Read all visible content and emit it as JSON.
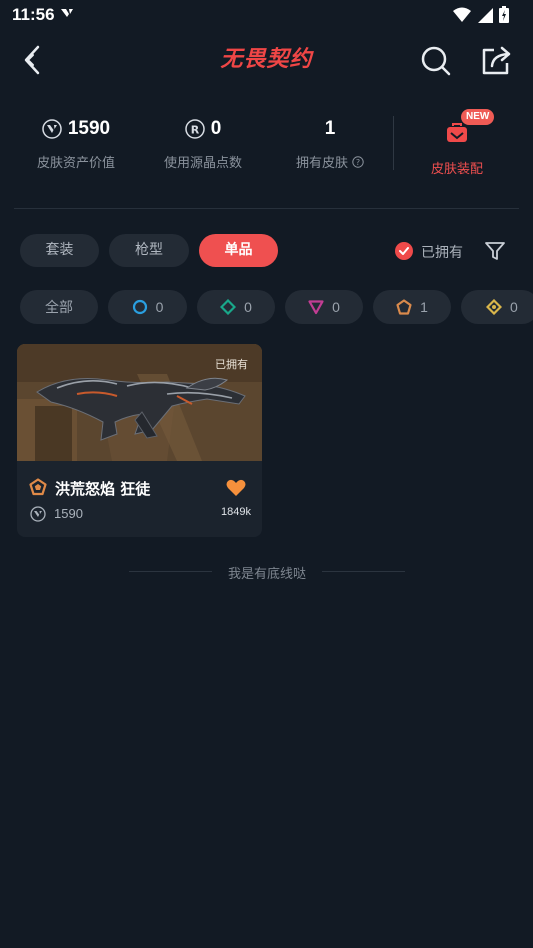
{
  "status_bar": {
    "time": "11:56"
  },
  "header": {
    "title": "无畏契约"
  },
  "stats": {
    "asset_value": "1590",
    "asset_value_label": "皮肤资产价值",
    "radianite_used": "0",
    "radianite_used_label": "使用源晶点数",
    "owned_skins": "1",
    "owned_skins_label": "拥有皮肤",
    "skin_equip_label": "皮肤装配",
    "new_badge": "NEW"
  },
  "tabs": [
    {
      "label": "套装"
    },
    {
      "label": "枪型"
    },
    {
      "label": "单品"
    }
  ],
  "owned_filter_label": "已拥有",
  "rarity_chips": [
    {
      "label": "全部"
    },
    {
      "count": "0",
      "color": "#2a9fe0"
    },
    {
      "count": "0",
      "color": "#19a88a"
    },
    {
      "count": "0",
      "color": "#c23d93"
    },
    {
      "count": "1",
      "color": "#d98a4c"
    },
    {
      "count": "0",
      "color": "#d9b64b"
    }
  ],
  "item_card": {
    "owned_tag": "已拥有",
    "name": "洪荒怒焰 狂徒",
    "price": "1590",
    "likes": "1849k"
  },
  "footer_text": "我是有底线哒",
  "colors": {
    "accent": "#ef5050",
    "background": "#121a24",
    "heart": "#f6903c"
  }
}
